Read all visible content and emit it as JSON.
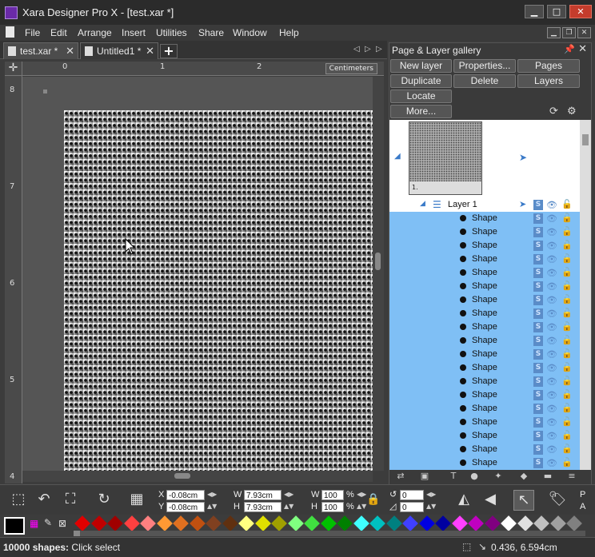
{
  "window": {
    "title": "Xara Designer Pro X - [test.xar *]",
    "minimize": "▁",
    "maximize": "□",
    "close": "✕"
  },
  "menu": {
    "items": [
      "File",
      "Edit",
      "Arrange",
      "Insert",
      "Utilities",
      "Share",
      "Window",
      "Help"
    ],
    "mdi_min": "▁",
    "mdi_restore": "❐",
    "mdi_close": "✕"
  },
  "tabs": {
    "items": [
      {
        "label": "test.xar *",
        "active": true
      },
      {
        "label": "Untitled1 *",
        "active": false
      }
    ],
    "close": "✕",
    "add": "+",
    "left_arrow": "◁",
    "right_arrow": "▷",
    "doc_arrow": "▷"
  },
  "ruler": {
    "units": "Centimeters",
    "h_ticks": [
      "0",
      "1",
      "2"
    ],
    "v_ticks": [
      "8",
      "7",
      "6",
      "5",
      "4"
    ],
    "corner": "✛"
  },
  "gallery": {
    "title": "Page & Layer gallery",
    "pin": "📌",
    "close": "✕",
    "buttons": {
      "new_layer": "New  layer",
      "properties": "Properties...",
      "pages": "Pages",
      "duplicate": "Duplicate",
      "delete": "Delete",
      "layers": "Layers",
      "locate": "Locate",
      "more": "More..."
    },
    "page_number": "1.",
    "layer_name": "Layer 1",
    "shape_label": "Shape",
    "shape_count_visible": 19,
    "s_badge": "S",
    "eye": "👁",
    "lock": "🔓",
    "expand_arrow": "◢",
    "select_arrow": "➤"
  },
  "infobar": {
    "x_label": "X",
    "y_label": "Y",
    "w_label": "W",
    "h_label": "H",
    "x_value": "-0.08cm",
    "y_value": "-0.08cm",
    "w_value": "7.93cm",
    "h_value": "7.93cm",
    "w_pct": "100",
    "h_pct": "100",
    "pct_sign": "%",
    "rotate_value": "0",
    "skew_value": "0"
  },
  "colors": {
    "swatches": [
      "#e00000",
      "#c00000",
      "#a00000",
      "#ff4040",
      "#ff8080",
      "#ff9933",
      "#e07020",
      "#c05010",
      "#804020",
      "#603010",
      "#ffff80",
      "#e0e000",
      "#a0a000",
      "#80ff80",
      "#40e040",
      "#00c000",
      "#008000",
      "#40ffff",
      "#00c0c0",
      "#008080",
      "#4040ff",
      "#0000e0",
      "#0000a0",
      "#ff40ff",
      "#c000c0",
      "#800080",
      "#ffffff",
      "#e0e0e0",
      "#c0c0c0",
      "#a0a0a0",
      "#808080"
    ]
  },
  "status": {
    "shapes_count": "10000 shapes:",
    "hint": "Click select",
    "coords": "0.436, 6.594cm"
  }
}
